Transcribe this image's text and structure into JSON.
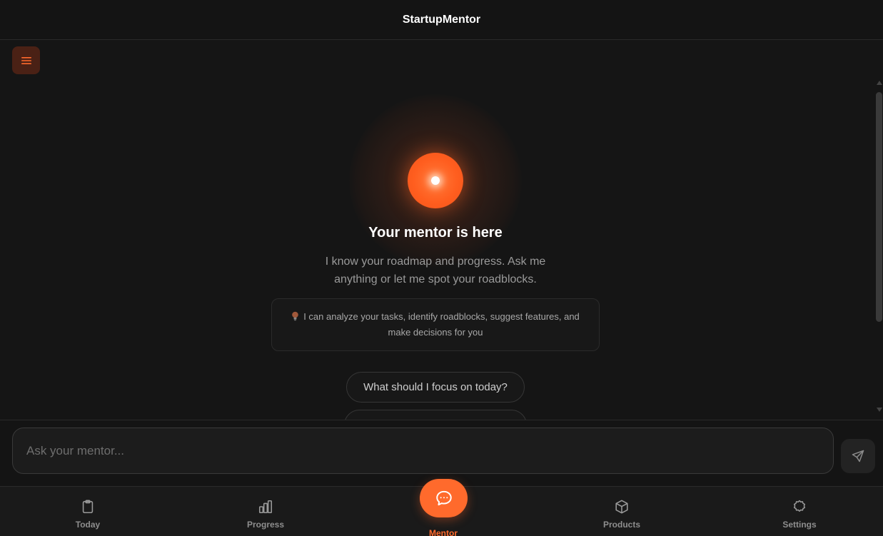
{
  "header": {
    "title": "StartupMentor"
  },
  "menu_button": {
    "icon": "hamburger-icon",
    "accent": "#ff6a2c"
  },
  "hero": {
    "title": "Your mentor is here",
    "subtitle": "I know your roadmap and progress. Ask me anything or let me spot your roadblocks.",
    "info": "I can analyze your tasks, identify roadblocks, suggest features, and make decisions for you",
    "info_icon": "lightbulb-icon"
  },
  "suggestions": [
    {
      "label": "What should I focus on today?"
    },
    {
      "label": ""
    }
  ],
  "composer": {
    "placeholder": "Ask your mentor...",
    "value": ""
  },
  "tabs": [
    {
      "label": "Today",
      "icon": "clipboard-icon"
    },
    {
      "label": "Progress",
      "icon": "bar-chart-icon"
    },
    {
      "label": "Mentor",
      "icon": "chat-bubble-icon",
      "active": true
    },
    {
      "label": "Products",
      "icon": "cube-icon"
    },
    {
      "label": "Settings",
      "icon": "gear-icon"
    }
  ],
  "colors": {
    "accent": "#ff6a2c",
    "background": "#141414"
  }
}
